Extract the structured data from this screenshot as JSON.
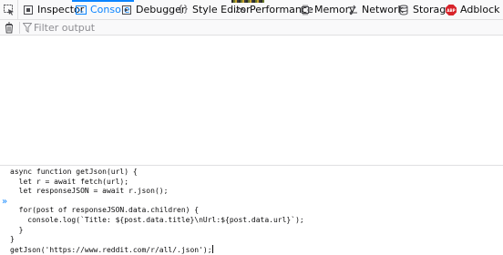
{
  "tabs": [
    {
      "label": "Inspector",
      "icon": "inspector-icon",
      "selected": false
    },
    {
      "label": "Console",
      "icon": "console-icon",
      "selected": true
    },
    {
      "label": "Debugger",
      "icon": "debugger-icon",
      "selected": false
    },
    {
      "label": "Style Editor",
      "icon": "style-editor-icon",
      "selected": false
    },
    {
      "label": "Performance",
      "icon": "performance-icon",
      "selected": false
    },
    {
      "label": "Memory",
      "icon": "memory-icon",
      "selected": false
    },
    {
      "label": "Network",
      "icon": "network-icon",
      "selected": false
    },
    {
      "label": "Storage",
      "icon": "storage-icon",
      "selected": false
    },
    {
      "label": "Adblock Plus",
      "icon": "adblock-plus-icon",
      "selected": false
    }
  ],
  "adblock_badge": "ABP",
  "filter": {
    "placeholder": "Filter output",
    "value": ""
  },
  "editor": {
    "code_lines": [
      "async function getJson(url) {",
      "  let r = await fetch(url);",
      "  let responseJSON = await r.json();",
      "",
      "  for(post of responseJSON.data.children) {",
      "    console.log(`Title: ${post.data.title}\\nUrl:${post.data.url}`);",
      "  }",
      "}",
      "getJson('https://www.reddit.com/r/all/.json');"
    ]
  },
  "colors": {
    "accent": "#0a84ff",
    "toolbar_bg": "#f9f9fa",
    "border": "#e0e0e2",
    "adblock_red": "#d8232a"
  }
}
